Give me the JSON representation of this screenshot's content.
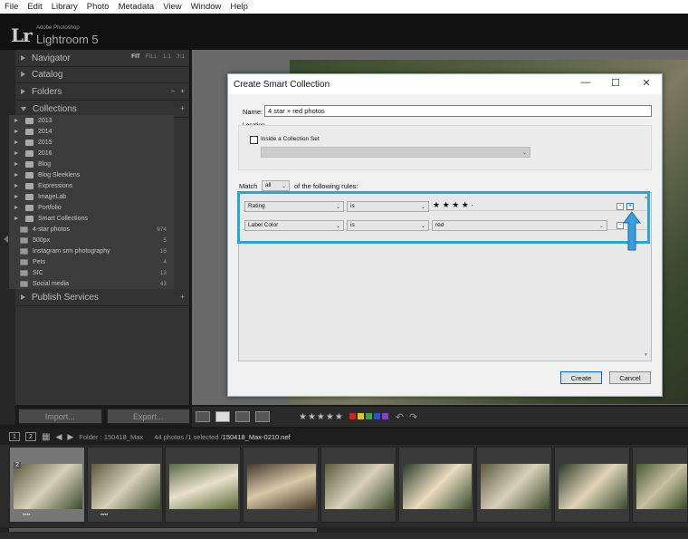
{
  "menubar": [
    "File",
    "Edit",
    "Library",
    "Photo",
    "Metadata",
    "View",
    "Window",
    "Help"
  ],
  "header": {
    "logo": "Lr",
    "subtitle": "Adobe Photoshop",
    "app_name": "Lightroom 5"
  },
  "panel": {
    "navigator": "Navigator",
    "nav_options": [
      "FIT",
      "FILL",
      "1:1",
      "3:1"
    ],
    "catalog": "Catalog",
    "folders": "Folders",
    "collections": "Collections",
    "publish": "Publish Services",
    "plus": "+",
    "minus": "−"
  },
  "collections": [
    {
      "label": "2013",
      "count": ""
    },
    {
      "label": "2014",
      "count": ""
    },
    {
      "label": "2015",
      "count": ""
    },
    {
      "label": "2016",
      "count": ""
    },
    {
      "label": "Blog",
      "count": ""
    },
    {
      "label": "Blog Sleeklens",
      "count": ""
    },
    {
      "label": "Expressions",
      "count": ""
    },
    {
      "label": "ImageLab",
      "count": ""
    },
    {
      "label": "Portfolio",
      "count": ""
    },
    {
      "label": "Smart Collections",
      "count": ""
    },
    {
      "label": "4-star photos",
      "count": "974"
    },
    {
      "label": "500px",
      "count": "5"
    },
    {
      "label": "Instagram srm photography",
      "count": "16"
    },
    {
      "label": "Pets",
      "count": "4"
    },
    {
      "label": "SIC",
      "count": "13"
    },
    {
      "label": "Social media",
      "count": "43"
    }
  ],
  "buttons": {
    "import": "Import...",
    "export": "Export..."
  },
  "dialog": {
    "title": "Create Smart Collection",
    "name_label": "Name:",
    "name_value": "4 star + red photos",
    "location_label": "Location",
    "inside_set": "Inside a Collection Set",
    "match_label": "Match",
    "match_value": "all",
    "rules_suffix": "of the following rules:",
    "rules": [
      {
        "field": "Rating",
        "op": "is",
        "value": "★ ★ ★ ★ ·"
      },
      {
        "field": "Label Color",
        "op": "is",
        "value": "red"
      }
    ],
    "create": "Create",
    "cancel": "Cancel",
    "minimize": "—",
    "maximize": "☐",
    "close": "✕"
  },
  "toolbar": {
    "stars": "★★★★★"
  },
  "filmstrip": {
    "page1": "1",
    "page2": "2",
    "folder": "Folder : 150418_Max",
    "info": "44 photos /1 selected /",
    "filename": "150418_Max-0210.nef",
    "selected_index": "2",
    "stars": "••••"
  },
  "colors": {
    "highlight": "#29a8cf",
    "label_colors": [
      "#d02020",
      "#d8c820",
      "#3ca83c",
      "#3050d0",
      "#8a40c0"
    ]
  }
}
